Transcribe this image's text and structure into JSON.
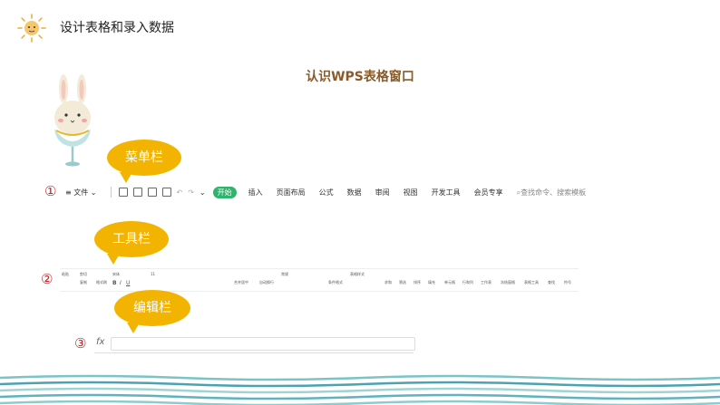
{
  "header": {
    "title": "设计表格和录入数据"
  },
  "slide": {
    "title": "认识WPS表格窗口"
  },
  "callouts": {
    "menu": {
      "number": "①",
      "label": "菜单栏"
    },
    "toolbar": {
      "number": "②",
      "label": "工具栏"
    },
    "editbar": {
      "number": "③",
      "label": "编辑栏"
    }
  },
  "menubar": {
    "file": "文件",
    "tabs": [
      "开始",
      "插入",
      "页面布局",
      "公式",
      "数据",
      "审阅",
      "视图",
      "开发工具",
      "会员专享"
    ],
    "search_placeholder": "查找命令、搜索模板"
  },
  "toolbar": {
    "items": [
      "粘贴",
      "剪切",
      "复制",
      "格式刷",
      "宋体",
      "11",
      "合并居中",
      "自动换行",
      "常规",
      "条件格式",
      "表格样式",
      "求和",
      "筛选",
      "排序",
      "填充",
      "单元格",
      "行和列",
      "工作表",
      "冻结窗格",
      "表格工具",
      "查找",
      "符号"
    ]
  },
  "formula_bar": {
    "fx_label": "fx",
    "value": ""
  },
  "colors": {
    "accent_bubble": "#f2b400",
    "number_red": "#c0282e",
    "active_tab": "#2eb46b",
    "title_brown": "#8a5a2b"
  }
}
